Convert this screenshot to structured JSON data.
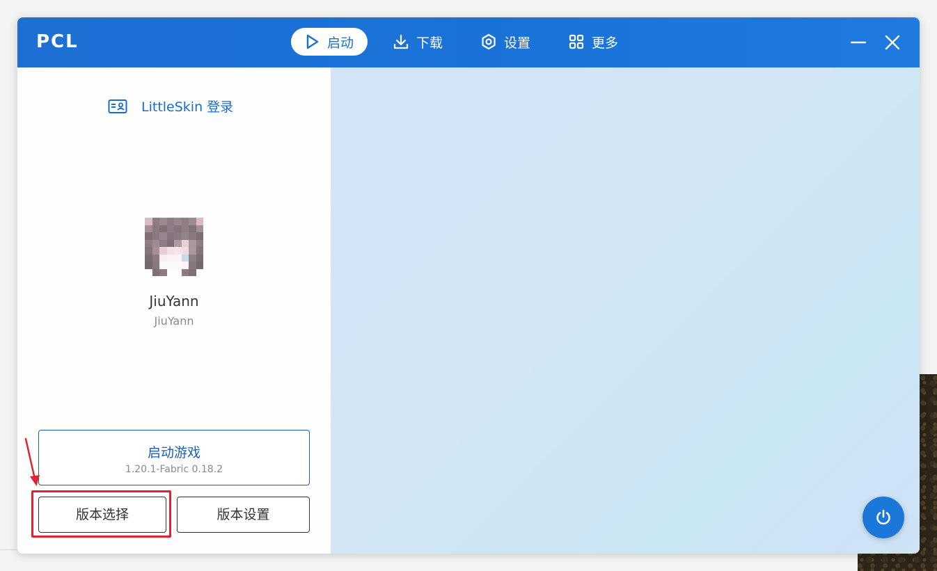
{
  "window": {
    "title": "PCL"
  },
  "nav": [
    {
      "label": "启动",
      "icon": "play-icon",
      "active": true
    },
    {
      "label": "下载",
      "icon": "download-icon",
      "active": false
    },
    {
      "label": "设置",
      "icon": "settings-icon",
      "active": false
    },
    {
      "label": "更多",
      "icon": "grid-icon",
      "active": false
    }
  ],
  "sidebar": {
    "login_label": "LittleSkin 登录",
    "user": {
      "name": "JiuYann",
      "sub": "JiuYann"
    },
    "launch": {
      "title": "启动游戏",
      "version": "1.20.1-Fabric 0.18.2"
    },
    "version_select_label": "版本选择",
    "version_settings_label": "版本设置"
  },
  "colors": {
    "accent": "#1a6fd3",
    "highlight": "#e0242f",
    "power": "#1c78d8"
  }
}
